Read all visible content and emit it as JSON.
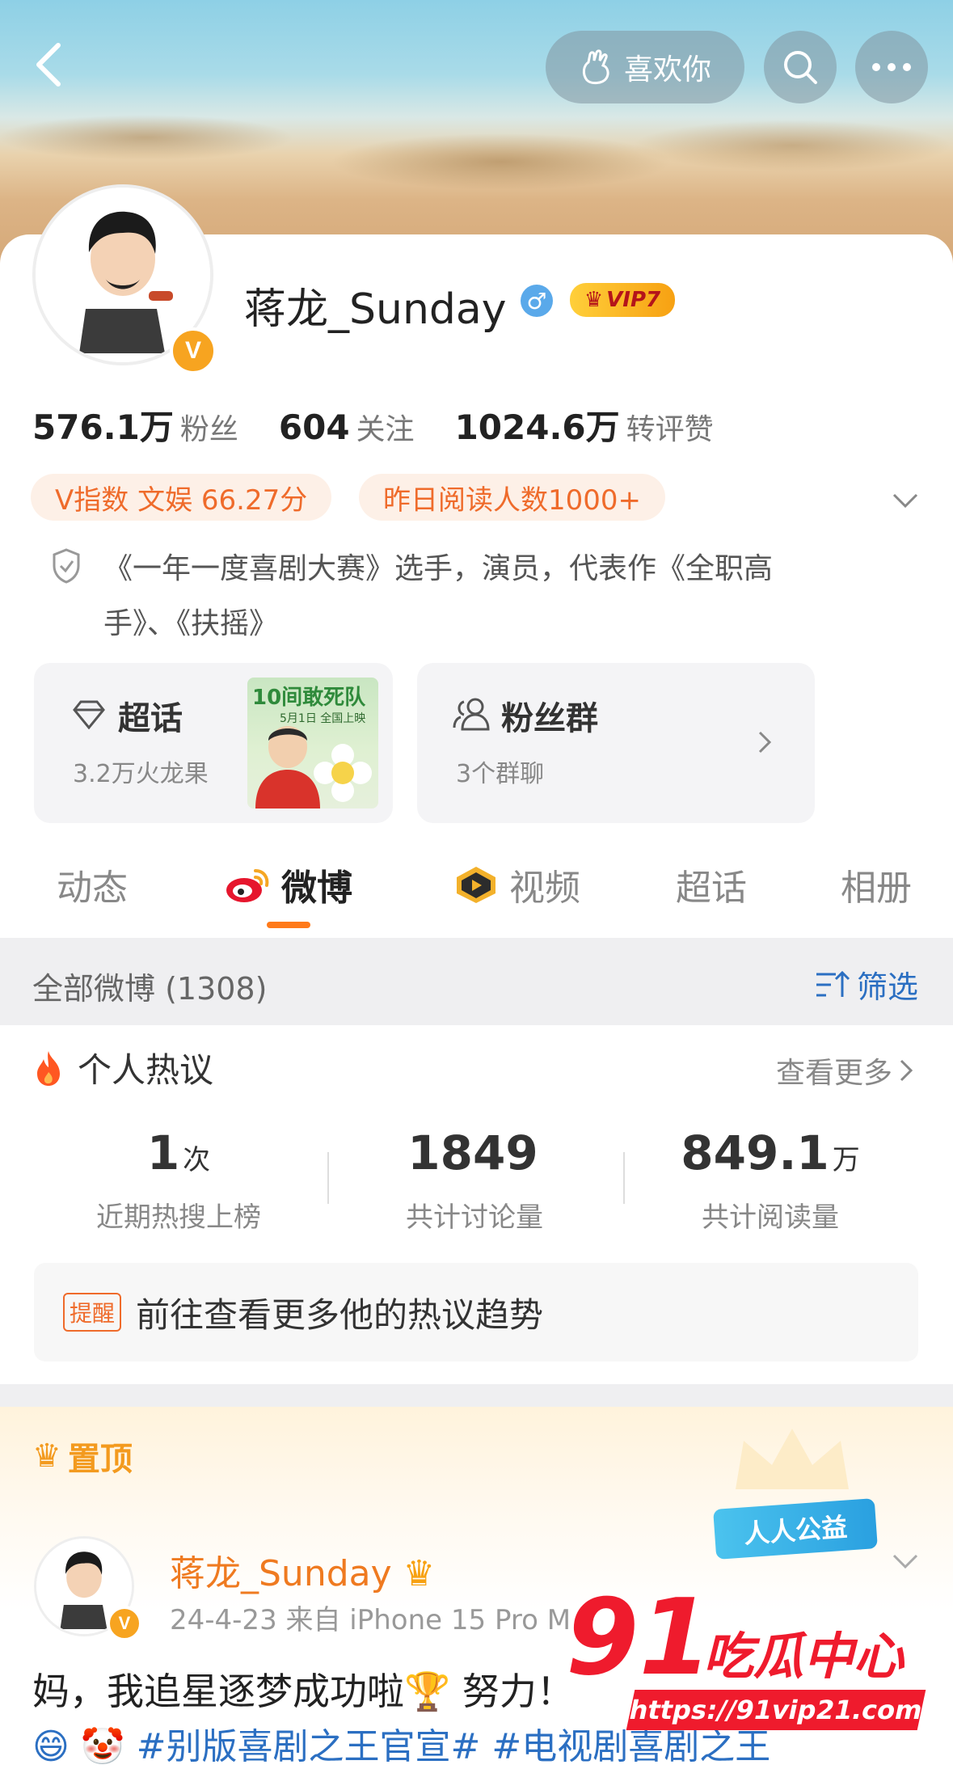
{
  "header": {
    "like_label": "喜欢你"
  },
  "profile": {
    "name": "蒋龙_Sunday",
    "gender_symbol": "♂",
    "vip_label": "VIP7",
    "avatar_badge": "V",
    "stats": [
      {
        "value": "576.1万",
        "label": "粉丝"
      },
      {
        "value": "604",
        "label": "关注"
      },
      {
        "value": "1024.6万",
        "label": "转评赞"
      }
    ],
    "tags": {
      "v_index": "V指数 文娱 66.27分",
      "reads": "昨日阅读人数1000+"
    },
    "bio_line1": "《一年一度喜剧大赛》选手，演员，代表作《全职高",
    "bio_line2": "手》、《扶摇》"
  },
  "tiles": {
    "topic_title": "超话",
    "topic_sub": "3.2万火龙果",
    "poster_title": "10间敢死队",
    "poster_date": "5月1日 全国上映",
    "fans_title": "粉丝群",
    "fans_sub": "3个群聊"
  },
  "tabs": [
    {
      "label": "动态"
    },
    {
      "label": "微博"
    },
    {
      "label": "视频"
    },
    {
      "label": "超话"
    },
    {
      "label": "相册"
    }
  ],
  "filter": {
    "all_label": "全部微博 (1308)",
    "filter_label": "筛选"
  },
  "hot": {
    "title": "个人热议",
    "see_more": "查看更多",
    "stats": [
      {
        "value": "1",
        "unit": "次",
        "label": "近期热搜上榜"
      },
      {
        "value": "1849",
        "unit": "",
        "label": "共计讨论量"
      },
      {
        "value": "849.1",
        "unit": "万",
        "label": "共计阅读量"
      }
    ],
    "reminder_tag": "提醒",
    "reminder_text": "前往查看更多他的热议趋势"
  },
  "pinned": {
    "label": "置顶",
    "charity": "人人公益",
    "user": "蒋龙_Sunday",
    "meta": "24-4-23  来自 iPhone 15 Pro M",
    "text": "妈，我追星逐梦成功啦🏆 努力！",
    "text2": "😄 🤡 #别版喜剧之王官宣# #电视剧喜剧之王"
  },
  "watermark": {
    "number": "91",
    "brand": "吃瓜中心",
    "url": "https://91vip21.com"
  },
  "colors": {
    "accent_orange": "#ef6b2b",
    "link_blue": "#2b6fc2",
    "vip_gold": "#f7a112"
  }
}
